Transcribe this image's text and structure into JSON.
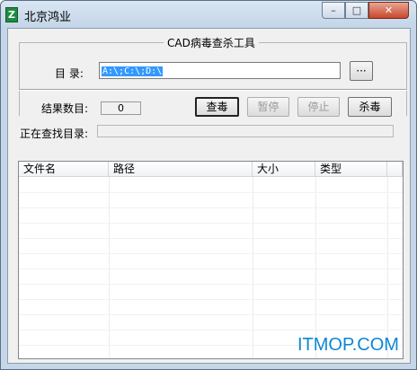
{
  "window": {
    "title": "北京鸿业",
    "minimize_label": "–",
    "maximize_label": "□",
    "close_label": "✕"
  },
  "group": {
    "title": "CAD病毒查杀工具"
  },
  "directory": {
    "label": "目 录:",
    "value": "A:\\;C:\\;D:\\",
    "browse_label": "···"
  },
  "results": {
    "count_label": "结果数目:",
    "count_value": "0",
    "searching_label": "正在查找目录:"
  },
  "buttons": {
    "scan": "查毒",
    "pause": "暂停",
    "stop": "停止",
    "kill": "杀毒"
  },
  "table": {
    "columns": [
      "文件名",
      "路径",
      "大小",
      "类型"
    ]
  },
  "watermark": "ITMOP.COM",
  "colors": {
    "selection": "#3399ff",
    "watermark": "#0e86d4",
    "close_button": "#c8472c"
  }
}
